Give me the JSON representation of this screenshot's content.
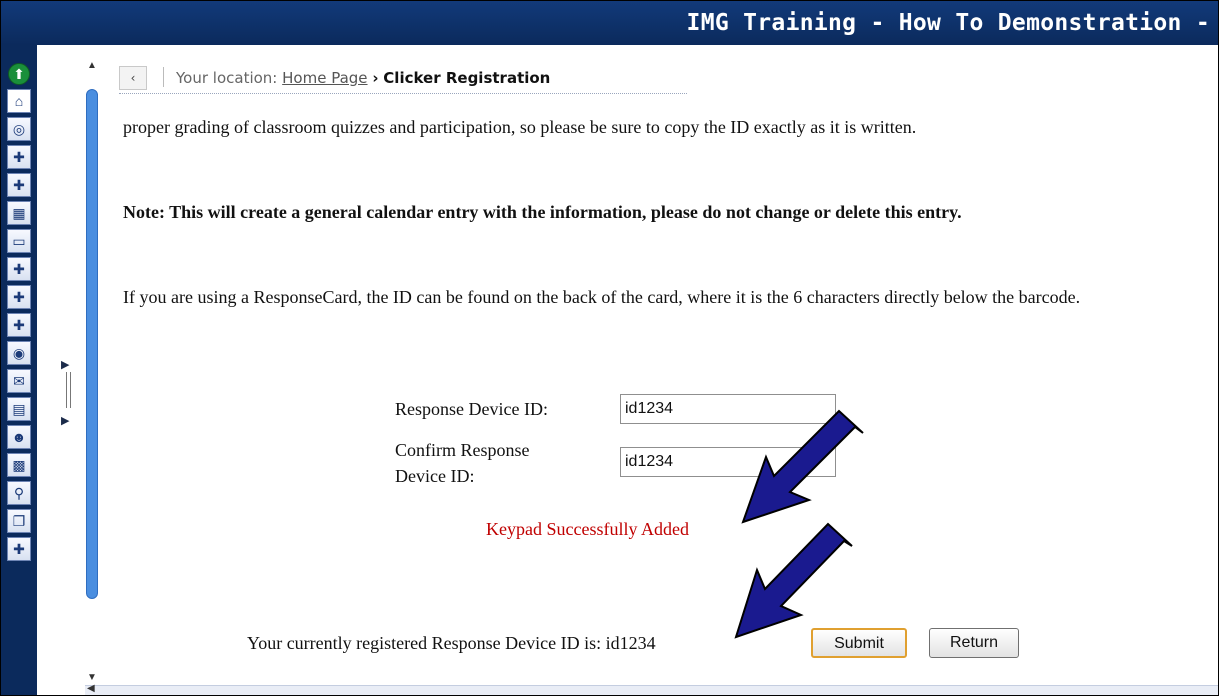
{
  "window": {
    "title": "IMG Training - How To Demonstration -"
  },
  "toolbar": {
    "icons": [
      "arrow-up-circle-icon",
      "home-icon",
      "satellite-dish-icon",
      "add-users-icon",
      "add-key-icon",
      "calculator-icon",
      "chat-bubble-icon",
      "add-tools-icon",
      "add-picture-icon",
      "add-document-icon",
      "compass-icon",
      "envelope-icon",
      "document-icon",
      "users-group-icon",
      "scorm-icon",
      "search-icon",
      "copy-icon",
      "add-grid-icon"
    ]
  },
  "location": {
    "back_glyph": "‹",
    "prefix": "Your location:",
    "home_link": "Home Page",
    "separator": "›",
    "current": "Clicker Registration"
  },
  "content": {
    "p1": "proper grading of classroom quizzes and participation, so please be sure to copy the ID exactly as it is written.",
    "note": "Note: This will create a general calendar entry with the information, please do not change or delete this entry.",
    "p2": "If you are using a ResponseCard, the ID can be found on the back of the card, where it is the 6 characters directly below the barcode."
  },
  "form": {
    "device_id_label": "Response Device ID:",
    "device_id_value": "id1234",
    "confirm_label_line1": "Confirm Response",
    "confirm_label_line2": "Device ID:",
    "confirm_value": "id1234",
    "success_message": "Keypad Successfully Added",
    "registered_text": "Your currently registered Response Device ID is: id1234",
    "submit_label": "Submit",
    "return_label": "Return"
  },
  "colors": {
    "title_bar": "#0b2a5c",
    "success_text": "#c00000",
    "arrow_fill": "#1a1a8f",
    "submit_border": "#e0a030"
  }
}
